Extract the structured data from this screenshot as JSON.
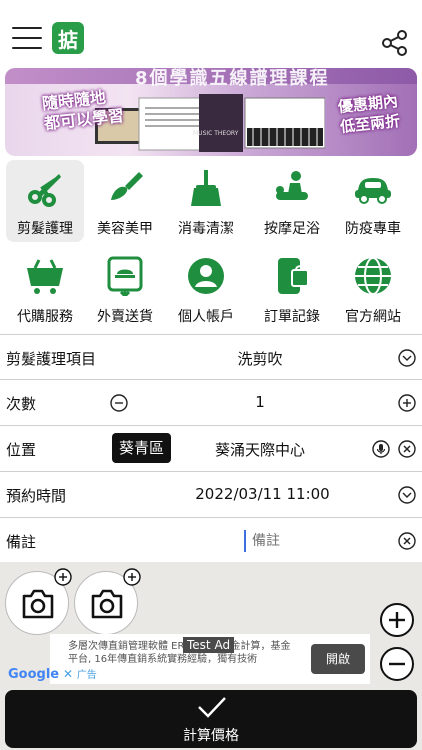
{
  "header": {
    "logo_char": "掂",
    "brand_color": "#2a9d48"
  },
  "banner": {
    "title": "8個學識五線譜理課程",
    "left_line1": "隨時隨地",
    "left_line2": "都可以學習",
    "right_line1": "優惠期內",
    "right_line2": "低至兩折",
    "card_text": "MUSIC THEORY"
  },
  "services": [
    {
      "label": "剪髮護理",
      "icon": "scissors-icon",
      "selected": true
    },
    {
      "label": "美容美甲",
      "icon": "brush-icon",
      "selected": false
    },
    {
      "label": "消毒清潔",
      "icon": "broom-icon",
      "selected": false
    },
    {
      "label": "按摩足浴",
      "icon": "massage-icon",
      "selected": false
    },
    {
      "label": "防疫專車",
      "icon": "car-icon",
      "selected": false
    },
    {
      "label": "代購服務",
      "icon": "cart-icon",
      "selected": false
    },
    {
      "label": "外賣送貨",
      "icon": "delivery-icon",
      "selected": false
    },
    {
      "label": "個人帳戶",
      "icon": "user-icon",
      "selected": false
    },
    {
      "label": "訂單記錄",
      "icon": "order-icon",
      "selected": false
    },
    {
      "label": "官方網站",
      "icon": "globe-icon",
      "selected": false
    }
  ],
  "form": {
    "item_label": "剪髮護理項目",
    "item_value": "洗剪吹",
    "qty_label": "次數",
    "qty_value": "1",
    "location_label": "位置",
    "district": "葵青區",
    "location_value": "葵涌天際中心",
    "time_label": "預約時間",
    "time_value": "2022/03/11 11:00",
    "note_label": "備註",
    "note_placeholder": "備註"
  },
  "ad": {
    "text": "多層次傳直銷管理軟體 ERP系統，獎金計算，基金平台, 16年傳直銷系統實務經驗，獨有技術",
    "tag": "Test Ad",
    "open_label": "開啟",
    "provider": "Google",
    "ad_word": "广告"
  },
  "calculate": {
    "label": "計算價格"
  }
}
